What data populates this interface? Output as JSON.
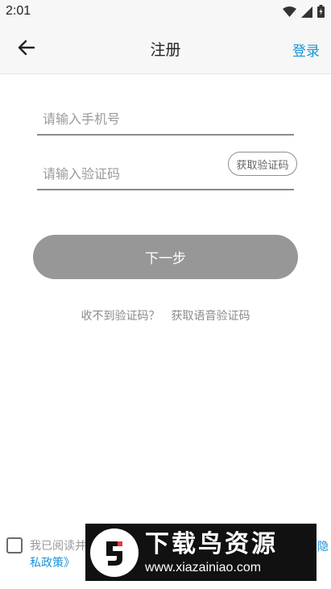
{
  "status_bar": {
    "time": "2:01",
    "icons": [
      "wifi-icon",
      "signal-icon",
      "battery-icon"
    ]
  },
  "app_bar": {
    "back_icon": "arrow-left-icon",
    "title": "注册",
    "login_label": "登录"
  },
  "form": {
    "phone_placeholder": "请输入手机号",
    "phone_value": "",
    "code_placeholder": "请输入验证码",
    "code_value": "",
    "get_code_label": "获取验证码",
    "next_label": "下一步"
  },
  "help": {
    "no_code_text": "收不到验证码？",
    "voice_code_link": "获取语音验证码"
  },
  "agreement": {
    "checked": false,
    "text_prefix": "我已阅读并",
    "link_tail_top": "隐",
    "link_line2": "私政策》"
  },
  "watermark": {
    "title": "下载鸟资源",
    "url": "www.xiazainiao.com"
  },
  "colors": {
    "accent": "#1a93d8",
    "button_disabled": "#979797",
    "app_bar_bg": "#f7f7f7"
  }
}
